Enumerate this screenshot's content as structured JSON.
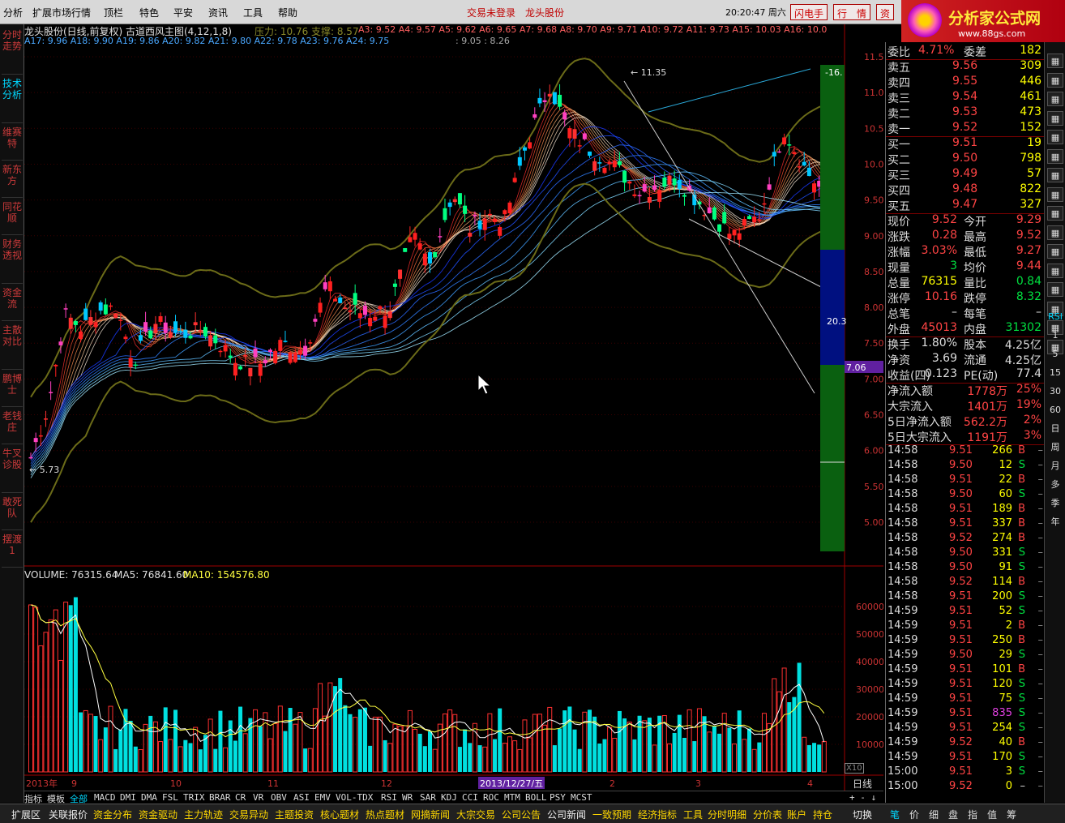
{
  "menu": [
    "分析",
    "扩展市场行情",
    "顶栏",
    "特色",
    "平安",
    "资讯",
    "工具",
    "帮助"
  ],
  "login_status": "交易未登录",
  "stock_short": "龙头股份",
  "clock": "20:20:47 周六",
  "top_buttons": [
    "闪电手",
    "行　情",
    "资"
  ],
  "logo": {
    "title": "分析家公式网",
    "url": "www.88gs.com"
  },
  "left_tabs": [
    "分时走势",
    "技术分析",
    "维赛特",
    "新东方",
    "同花顺",
    "财务透视",
    "资金流",
    "主散对比",
    "鹏博士",
    "老钱庄",
    "牛叉诊股",
    "敢死队",
    "摆渡1"
  ],
  "chart_header": {
    "title": "龙头股份(日线,前复权) 古道西风主图(4,12,1,8)",
    "pressure": "压力: 10.76",
    "support": "支撑: 8.57",
    "row1": "A3: 9.52  A4: 9.57  A5: 9.62  A6: 9.65  A7: 9.68  A8: 9.70  A9: 9.71  A10: 9.72  A11: 9.73  A15: 10.03  A16: 10.0",
    "row2": "A17: 9.96  A18: 9.90  A19: 9.86  A20: 9.82  A21: 9.80  A22: 9.78  A23: 9.76  A24: 9.75",
    "row2b": ": 9.05   : 8.26"
  },
  "price_axis": [
    "11.50",
    "11.00",
    "10.50",
    "10.00",
    "9.50",
    "9.00",
    "8.50",
    "8.00",
    "7.50",
    "7.00",
    "6.50",
    "6.00",
    "5.50",
    "5.00"
  ],
  "chart_annotations": {
    "high": "11.35",
    "low": "5.73",
    "tag1": "-16.",
    "tag2": "20.3",
    "tag3": "7.06"
  },
  "volume_header": {
    "label": "VOLUME: 76315.64",
    "ma5": "MA5: 76841.60",
    "ma10": "MA10: 154576.80"
  },
  "volume_axis": [
    "60000",
    "50000",
    "40000",
    "30000",
    "20000",
    "10000"
  ],
  "volume_unit": "X10",
  "date_axis": [
    {
      "label": "2013年"
    },
    {
      "label": "9"
    },
    {
      "label": "10"
    },
    {
      "label": "11"
    },
    {
      "label": "12"
    },
    {
      "label": "2013/12/27/五",
      "highlight": true
    },
    {
      "label": "2"
    },
    {
      "label": "3"
    },
    {
      "label": "4"
    }
  ],
  "period_label": "日线",
  "indicator_tabs": [
    "指标",
    "模板",
    "全部",
    "MACD",
    "DMI",
    "DMA",
    "FSL",
    "TRIX",
    "BRAR",
    "CR",
    "VR",
    "OBV",
    "ASI",
    "EMV",
    "VOL-TDX",
    "RSI",
    "WR",
    "SAR",
    "KDJ",
    "CCI",
    "ROC",
    "MTM",
    "BOLL",
    "PSY",
    "MCST"
  ],
  "indicator_active": "全部",
  "orderbook": {
    "weibi": {
      "label": "委比",
      "value": "4.71%",
      "label2": "委差",
      "value2": "182"
    },
    "sells": [
      {
        "label": "卖五",
        "price": "9.56",
        "vol": "309"
      },
      {
        "label": "卖四",
        "price": "9.55",
        "vol": "446"
      },
      {
        "label": "卖三",
        "price": "9.54",
        "vol": "461"
      },
      {
        "label": "卖二",
        "price": "9.53",
        "vol": "473"
      },
      {
        "label": "卖一",
        "price": "9.52",
        "vol": "152"
      }
    ],
    "buys": [
      {
        "label": "买一",
        "price": "9.51",
        "vol": "19"
      },
      {
        "label": "买二",
        "price": "9.50",
        "vol": "798"
      },
      {
        "label": "买三",
        "price": "9.49",
        "vol": "57"
      },
      {
        "label": "买四",
        "price": "9.48",
        "vol": "822"
      },
      {
        "label": "买五",
        "price": "9.47",
        "vol": "327"
      }
    ]
  },
  "quote_stats": [
    {
      "l1": "现价",
      "v1": "9.52",
      "c1": "#ff4444",
      "l2": "今开",
      "v2": "9.29",
      "c2": "#ff4444"
    },
    {
      "l1": "涨跌",
      "v1": "0.28",
      "c1": "#ff4444",
      "l2": "最高",
      "v2": "9.52",
      "c2": "#ff4444"
    },
    {
      "l1": "涨幅",
      "v1": "3.03%",
      "c1": "#ff4444",
      "l2": "最低",
      "v2": "9.27",
      "c2": "#ff4444"
    },
    {
      "l1": "现量",
      "v1": "3",
      "c1": "#00e040",
      "l2": "均价",
      "v2": "9.44",
      "c2": "#ff4444"
    },
    {
      "l1": "总量",
      "v1": "76315",
      "c1": "#ffff00",
      "l2": "量比",
      "v2": "0.84",
      "c2": "#00e040"
    },
    {
      "l1": "涨停",
      "v1": "10.16",
      "c1": "#ff4444",
      "l2": "跌停",
      "v2": "8.32",
      "c2": "#00e040"
    },
    {
      "l1": "总笔",
      "v1": "–",
      "c1": "#ddd",
      "l2": "每笔",
      "v2": "–",
      "c2": "#ddd"
    },
    {
      "l1": "外盘",
      "v1": "45013",
      "c1": "#ff4444",
      "l2": "内盘",
      "v2": "31302",
      "c2": "#00e040"
    }
  ],
  "fundamentals": [
    {
      "l1": "换手",
      "v1": "1.80%",
      "l2": "股本",
      "v2": "4.25亿"
    },
    {
      "l1": "净资",
      "v1": "3.69",
      "l2": "流通",
      "v2": "4.25亿"
    },
    {
      "l1": "收益(四)",
      "v1": "0.123",
      "l2": "PE(动)",
      "v2": "77.4"
    }
  ],
  "flows": [
    {
      "label": "净流入额",
      "value": "1778万",
      "pct": "25%"
    },
    {
      "label": "大宗流入",
      "value": "1401万",
      "pct": "19%"
    },
    {
      "label": "5日净流入额",
      "value": "562.2万",
      "pct": "2%"
    },
    {
      "label": "5日大宗流入",
      "value": "1191万",
      "pct": "3%"
    }
  ],
  "ticks": [
    {
      "t": "14:58",
      "p": "9.51",
      "v": "266",
      "s": "B"
    },
    {
      "t": "14:58",
      "p": "9.50",
      "v": "12",
      "s": "S"
    },
    {
      "t": "14:58",
      "p": "9.51",
      "v": "22",
      "s": "B"
    },
    {
      "t": "14:58",
      "p": "9.50",
      "v": "60",
      "s": "S"
    },
    {
      "t": "14:58",
      "p": "9.51",
      "v": "189",
      "s": "B"
    },
    {
      "t": "14:58",
      "p": "9.51",
      "v": "337",
      "s": "B"
    },
    {
      "t": "14:58",
      "p": "9.52",
      "v": "274",
      "s": "B"
    },
    {
      "t": "14:58",
      "p": "9.50",
      "v": "331",
      "s": "S"
    },
    {
      "t": "14:58",
      "p": "9.50",
      "v": "91",
      "s": "S"
    },
    {
      "t": "14:58",
      "p": "9.52",
      "v": "114",
      "s": "B"
    },
    {
      "t": "14:58",
      "p": "9.51",
      "v": "200",
      "s": "S"
    },
    {
      "t": "14:59",
      "p": "9.51",
      "v": "52",
      "s": "S"
    },
    {
      "t": "14:59",
      "p": "9.51",
      "v": "2",
      "s": "B"
    },
    {
      "t": "14:59",
      "p": "9.51",
      "v": "250",
      "s": "B"
    },
    {
      "t": "14:59",
      "p": "9.50",
      "v": "29",
      "s": "S"
    },
    {
      "t": "14:59",
      "p": "9.51",
      "v": "101",
      "s": "B"
    },
    {
      "t": "14:59",
      "p": "9.51",
      "v": "120",
      "s": "S"
    },
    {
      "t": "14:59",
      "p": "9.51",
      "v": "75",
      "s": "S"
    },
    {
      "t": "14:59",
      "p": "9.51",
      "v": "835",
      "s": "S",
      "purple": true
    },
    {
      "t": "14:59",
      "p": "9.51",
      "v": "254",
      "s": "S"
    },
    {
      "t": "14:59",
      "p": "9.52",
      "v": "40",
      "s": "B"
    },
    {
      "t": "14:59",
      "p": "9.51",
      "v": "170",
      "s": "S"
    },
    {
      "t": "15:00",
      "p": "9.51",
      "v": "3",
      "s": "S"
    },
    {
      "t": "15:00",
      "p": "9.52",
      "v": "0",
      "s": "–"
    }
  ],
  "right_tools": [
    "RSI",
    "1",
    "5",
    "15",
    "30",
    "60",
    "日",
    "周",
    "月",
    "多",
    "季",
    "年"
  ],
  "bottom_left": [
    "扩展区",
    "关联报价"
  ],
  "bottom_yellow": [
    "资金分布",
    "资金驱动",
    "主力轨迹",
    "交易异动",
    "主题投资",
    "核心题材",
    "热点题材",
    "网摘新闻",
    "大宗交易",
    "公司公告",
    "公司新闻",
    "一致预期",
    "经济指标",
    "工具",
    "分时明细",
    "分价表",
    "账户",
    "持仓"
  ],
  "bottom_right": [
    "切换"
  ],
  "bottom_panel_tabs": [
    "笔",
    "价",
    "细",
    "盘",
    "指",
    "值",
    "筹"
  ]
}
